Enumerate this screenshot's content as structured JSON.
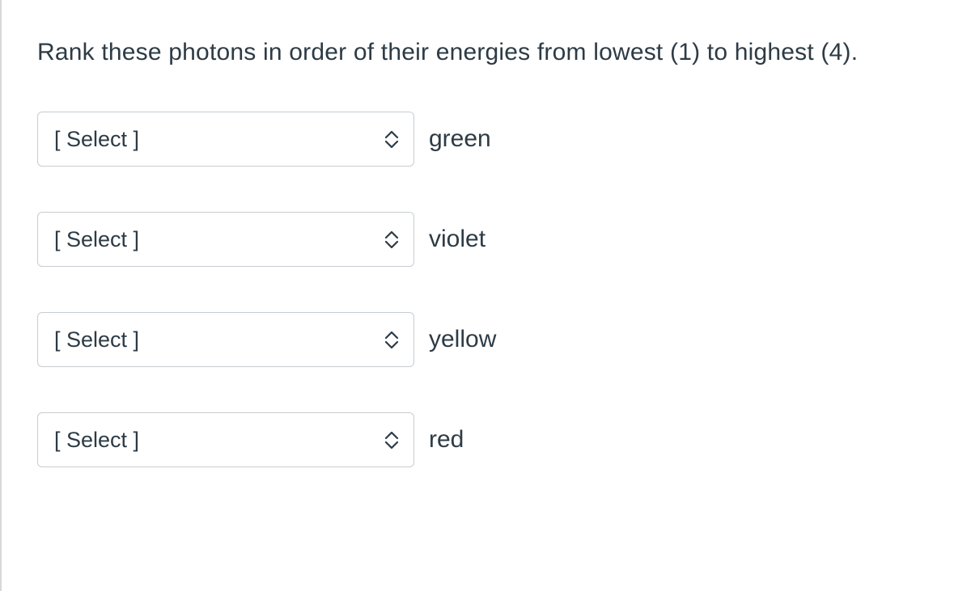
{
  "question": "Rank these photons in order of their energies from lowest (1) to highest (4).",
  "select_placeholder": "[ Select ]",
  "items": {
    "0": {
      "label": "green"
    },
    "1": {
      "label": "violet"
    },
    "2": {
      "label": "yellow"
    },
    "3": {
      "label": "red"
    }
  }
}
